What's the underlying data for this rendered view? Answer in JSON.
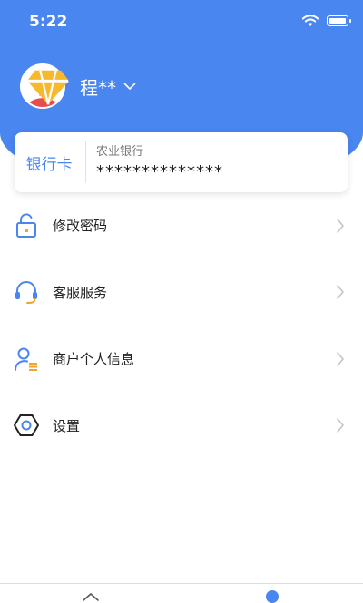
{
  "status_bar": {
    "time": "5:22"
  },
  "profile": {
    "name": "程**"
  },
  "bank_card": {
    "label": "银行卡",
    "bank_name": "农业银行",
    "card_number": "**************"
  },
  "menu": {
    "items": [
      {
        "label": "修改密码",
        "icon": "unlock-icon"
      },
      {
        "label": "客服服务",
        "icon": "headset-icon"
      },
      {
        "label": "商户个人信息",
        "icon": "user-info-icon"
      },
      {
        "label": "设置",
        "icon": "settings-hex-icon"
      }
    ]
  },
  "colors": {
    "accent": "#4a86f0",
    "icon_orange": "#f0a531"
  }
}
